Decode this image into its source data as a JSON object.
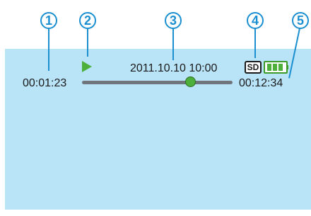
{
  "callouts": [
    "1",
    "2",
    "3",
    "4",
    "5"
  ],
  "hud": {
    "elapsed_time": "00:01:23",
    "date_time": "2011.10.10 10:00",
    "total_time": "00:12:34",
    "media_label": "SD",
    "playback_progress": 0.72,
    "battery_level_bars": 3
  },
  "colors": {
    "screen_bg": "#b9e3f6",
    "callout": "#1b8fd0",
    "play_icon": "#4db03b",
    "seek_knob": "#4db03b",
    "battery": "#3c9b28",
    "track": "#6f757a"
  },
  "icons": {
    "play": "play-icon",
    "media": "sd-card-icon",
    "battery": "battery-icon"
  }
}
